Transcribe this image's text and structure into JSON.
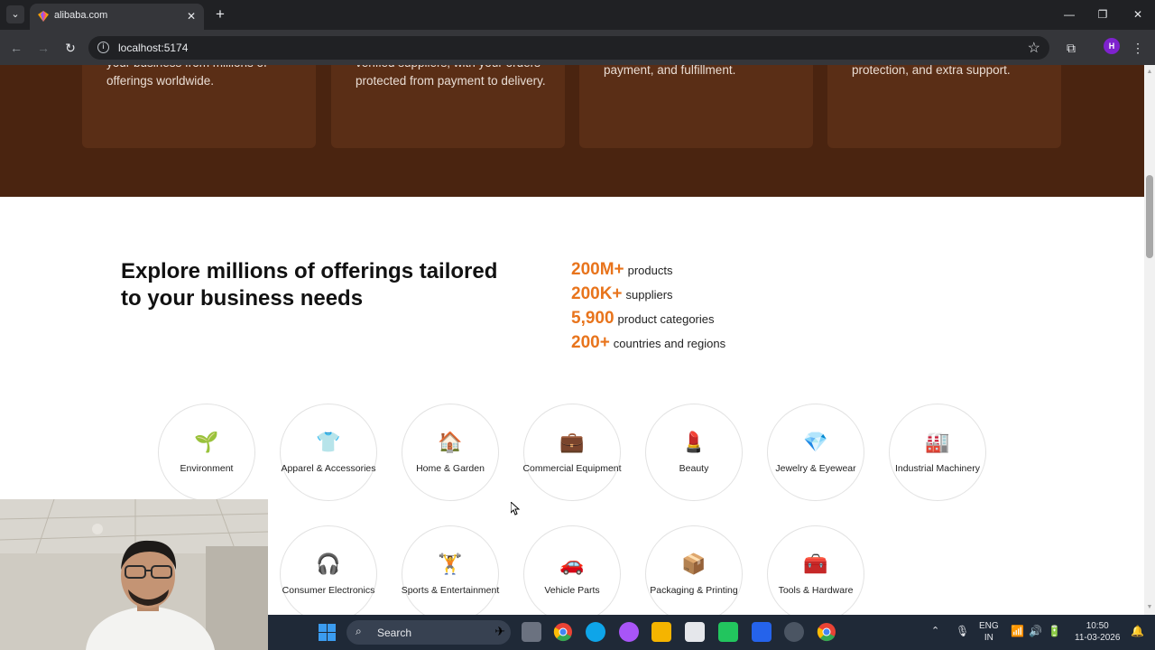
{
  "browser": {
    "tab_title": "alibaba.com",
    "url": "localhost:5174",
    "avatar_letter": "H"
  },
  "hero": {
    "cards": [
      {
        "text": "Explore products and suppliers for your business from millions of offerings worldwide."
      },
      {
        "text": "Ensure production quality from verified suppliers, with your orders protected from payment to delivery."
      },
      {
        "text": "procurement support, management, payment, and fulfillment."
      },
      {
        "text": "protection, and extra support."
      }
    ]
  },
  "offerings": {
    "headline": "Explore millions of offerings tailored to your business needs",
    "stats": [
      {
        "value": "200M+",
        "label": "products"
      },
      {
        "value": "200K+",
        "label": "suppliers"
      },
      {
        "value": "5,900",
        "label": "product categories"
      },
      {
        "value": "200+",
        "label": "countries and regions"
      }
    ]
  },
  "categories": [
    {
      "label": "Environment",
      "icon": "seedling-icon",
      "glyph": "🌱"
    },
    {
      "label": "Apparel & Accessories",
      "icon": "tshirt-icon",
      "glyph": "👕"
    },
    {
      "label": "Home & Garden",
      "icon": "house-icon",
      "glyph": "🏠"
    },
    {
      "label": "Commercial Equipment",
      "icon": "briefcase-icon",
      "glyph": "💼"
    },
    {
      "label": "Beauty",
      "icon": "lipstick-icon",
      "glyph": "💄"
    },
    {
      "label": "Jewelry & Eyewear",
      "icon": "gem-icon",
      "glyph": "💎"
    },
    {
      "label": "Industrial Machinery",
      "icon": "factory-icon",
      "glyph": "🏭"
    },
    {
      "label": "Consumer Electronics",
      "icon": "headphones-icon",
      "glyph": "🎧"
    },
    {
      "label": "Sports & Entertainment",
      "icon": "weightlifter-icon",
      "glyph": "🏋"
    },
    {
      "label": "Vehicle Parts",
      "icon": "car-icon",
      "glyph": "🚗"
    },
    {
      "label": "Packaging & Printing",
      "icon": "package-icon",
      "glyph": "📦"
    },
    {
      "label": "Tools & Hardware",
      "icon": "toolbox-icon",
      "glyph": "🧰"
    }
  ],
  "taskbar": {
    "search_label": "Search",
    "lang_top": "ENG",
    "lang_bottom": "IN",
    "time": "10:50",
    "date": "11-03-2026"
  },
  "colors": {
    "hero_bg": "#4a2410",
    "card_bg": "#5a2e16",
    "accent": "#e8741c"
  }
}
